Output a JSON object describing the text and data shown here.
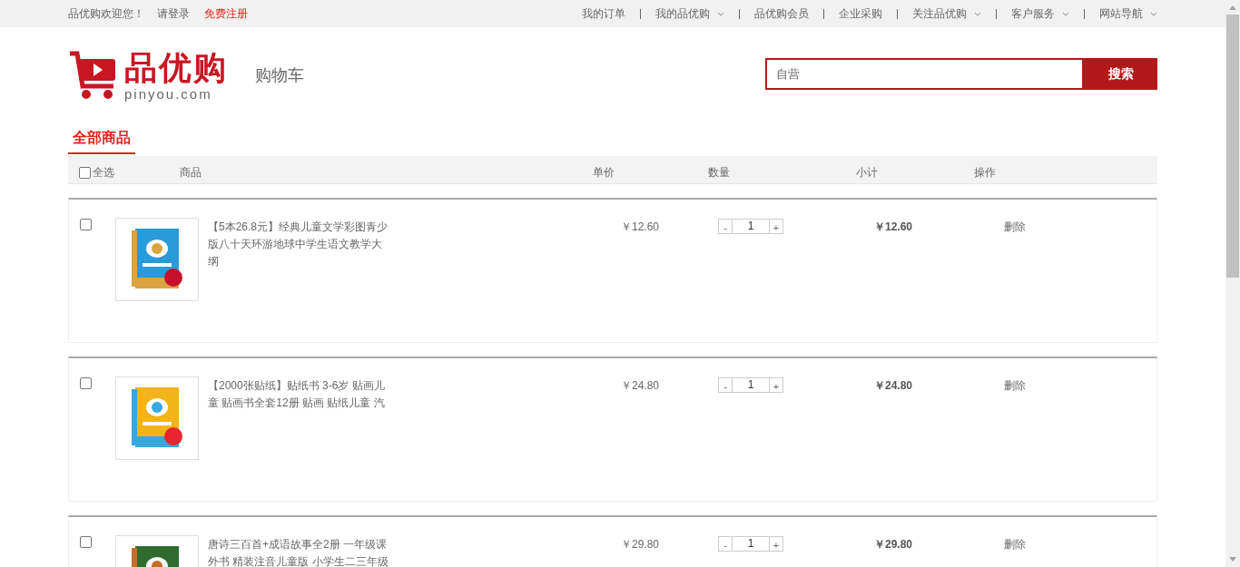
{
  "top_bar": {
    "welcome": "品优购欢迎您！",
    "login": "请登录",
    "register": "免费注册",
    "nav": [
      {
        "label": "我的订单",
        "has_menu": false
      },
      {
        "label": "我的品优购",
        "has_menu": true
      },
      {
        "label": "品优购会员",
        "has_menu": false
      },
      {
        "label": "企业采购",
        "has_menu": false
      },
      {
        "label": "关注品优购",
        "has_menu": true
      },
      {
        "label": "客户服务",
        "has_menu": true
      },
      {
        "label": "网站导航",
        "has_menu": true
      }
    ]
  },
  "header": {
    "logo": {
      "name": "品优购",
      "domain": "pinyou.com"
    },
    "page_title": "购物车",
    "search": {
      "value": "自营",
      "button": "搜索"
    }
  },
  "tabs": [
    {
      "label": "全部商品",
      "selected": true
    }
  ],
  "table": {
    "select_all": {
      "label": "全选",
      "checked": false
    },
    "columns": [
      "商品",
      "单价",
      "数量",
      "小计",
      "操作"
    ]
  },
  "items": [
    {
      "checked": false,
      "title": "【5本26.8元】经典儿童文学彩图青少版八十天环游地球中学生语文教学大纲",
      "price": "￥12.60",
      "quantity": "1",
      "minus": "-",
      "plus": "+",
      "subtotal": "￥12.60",
      "delete": "删除"
    },
    {
      "checked": false,
      "title": "【2000张贴纸】贴纸书 3-6岁 贴画儿童 贴画书全套12册 贴画 贴纸儿童 汽",
      "price": "￥24.80",
      "quantity": "1",
      "minus": "-",
      "plus": "+",
      "subtotal": "￥24.80",
      "delete": "删除"
    },
    {
      "checked": false,
      "title": "唐诗三百首+成语故事全2册 一年级课外书 精装注音儿童版 小学生二三年级",
      "price": "￥29.80",
      "quantity": "1",
      "minus": "-",
      "plus": "+",
      "subtotal": "￥29.80",
      "delete": "删除"
    }
  ]
}
